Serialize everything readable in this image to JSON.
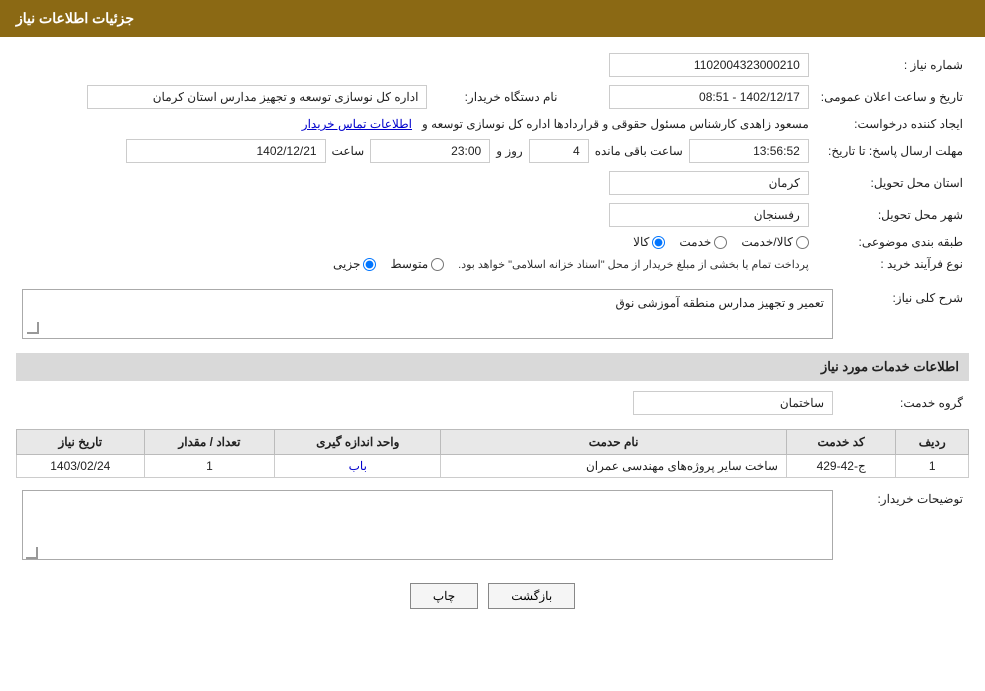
{
  "header": {
    "title": "جزئیات اطلاعات نیاز"
  },
  "fields": {
    "request_number_label": "شماره نیاز :",
    "request_number_value": "1102004323000210",
    "buyer_org_label": "نام دستگاه خریدار:",
    "buyer_org_value": "اداره کل نوسازی  توسعه  و تجهیز مدارس استان کرمان",
    "creator_label": "ایجاد کننده درخواست:",
    "creator_value": "مسعود زاهدی کارشناس مسئول حقوقی و قراردادها اداره کل نوسازی  توسعه  و",
    "contact_link": "اطلاعات تماس خریدار",
    "publish_date_label": "تاریخ و ساعت اعلان عمومی:",
    "publish_date_value": "1402/12/17 - 08:51",
    "deadline_label": "مهلت ارسال پاسخ: تا تاریخ:",
    "deadline_date": "1402/12/21",
    "deadline_time_label": "ساعت",
    "deadline_time": "23:00",
    "deadline_days_label": "روز و",
    "deadline_days": "4",
    "deadline_remaining_label": "ساعت باقی مانده",
    "deadline_remaining": "13:56:52",
    "province_label": "استان محل تحویل:",
    "province_value": "کرمان",
    "city_label": "شهر محل تحویل:",
    "city_value": "رفسنجان",
    "category_label": "طبقه بندی موضوعی:",
    "category_kala": "کالا",
    "category_khedmat": "خدمت",
    "category_kala_khedmat": "کالا/خدمت",
    "purchase_type_label": "نوع فرآیند خرید :",
    "purchase_jozei": "جزیی",
    "purchase_motawaset": "متوسط",
    "purchase_note": "پرداخت تمام یا بخشی از مبلغ خریدار از محل \"اسناد خزانه اسلامی\" خواهد بود.",
    "description_label": "شرح کلی نیاز:",
    "description_value": "تعمیر و تجهیز مدارس منطقه آموزشی نوق",
    "services_section": "اطلاعات خدمات مورد نیاز",
    "service_group_label": "گروه خدمت:",
    "service_group_value": "ساختمان",
    "table_headers": [
      "ردیف",
      "کد خدمت",
      "نام حدمت",
      "واحد اندازه گیری",
      "تعداد / مقدار",
      "تاریخ نیاز"
    ],
    "table_rows": [
      {
        "row": "1",
        "code": "ج-42-429",
        "name": "ساخت سایر پروژه‌های مهندسی عمران",
        "unit": "باب",
        "quantity": "1",
        "date": "1403/02/24"
      }
    ],
    "buyer_desc_label": "توضیحات خریدار:",
    "buyer_desc_value": "",
    "btn_print": "چاپ",
    "btn_back": "بازگشت"
  }
}
